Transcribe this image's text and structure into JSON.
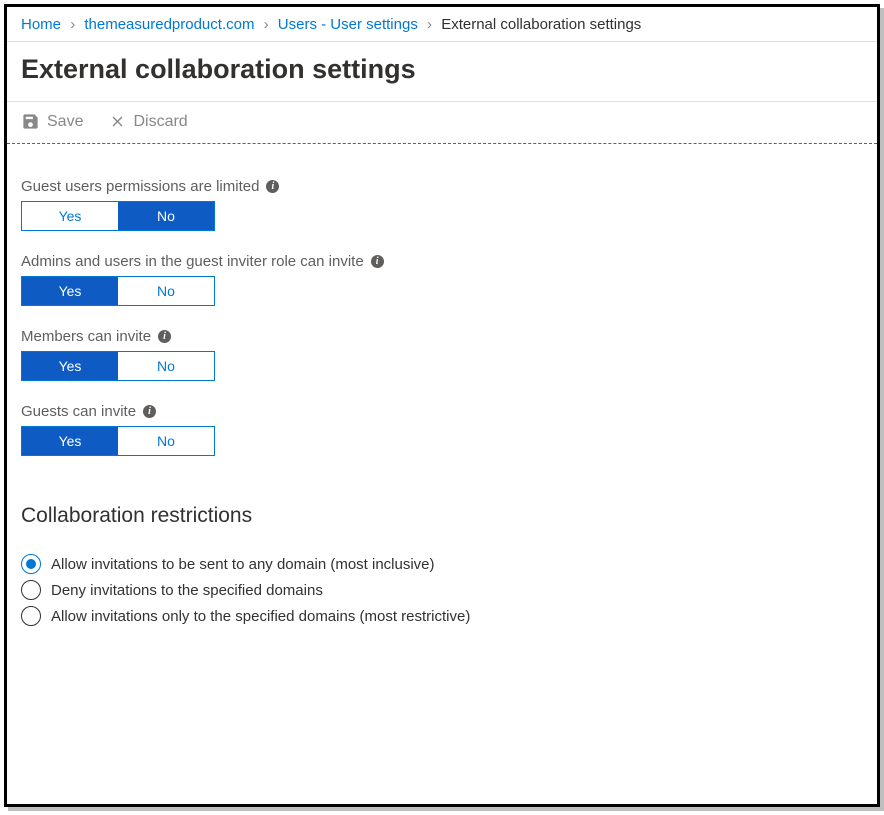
{
  "breadcrumb": {
    "items": [
      {
        "label": "Home",
        "link": true
      },
      {
        "label": "themeasuredproduct.com",
        "link": true
      },
      {
        "label": "Users - User settings",
        "link": true
      },
      {
        "label": "External collaboration settings",
        "link": false
      }
    ]
  },
  "page_title": "External collaboration settings",
  "toolbar": {
    "save_label": "Save",
    "discard_label": "Discard"
  },
  "toggles": [
    {
      "label": "Guest users permissions are limited",
      "yes": "Yes",
      "no": "No",
      "value": "No"
    },
    {
      "label": "Admins and users in the guest inviter role can invite",
      "yes": "Yes",
      "no": "No",
      "value": "Yes"
    },
    {
      "label": "Members can invite",
      "yes": "Yes",
      "no": "No",
      "value": "Yes"
    },
    {
      "label": "Guests can invite",
      "yes": "Yes",
      "no": "No",
      "value": "Yes"
    }
  ],
  "restrictions": {
    "heading": "Collaboration restrictions",
    "options": [
      {
        "label": "Allow invitations to be sent to any domain (most inclusive)",
        "selected": true
      },
      {
        "label": "Deny invitations to the specified domains",
        "selected": false
      },
      {
        "label": "Allow invitations only to the specified domains (most restrictive)",
        "selected": false
      }
    ]
  }
}
